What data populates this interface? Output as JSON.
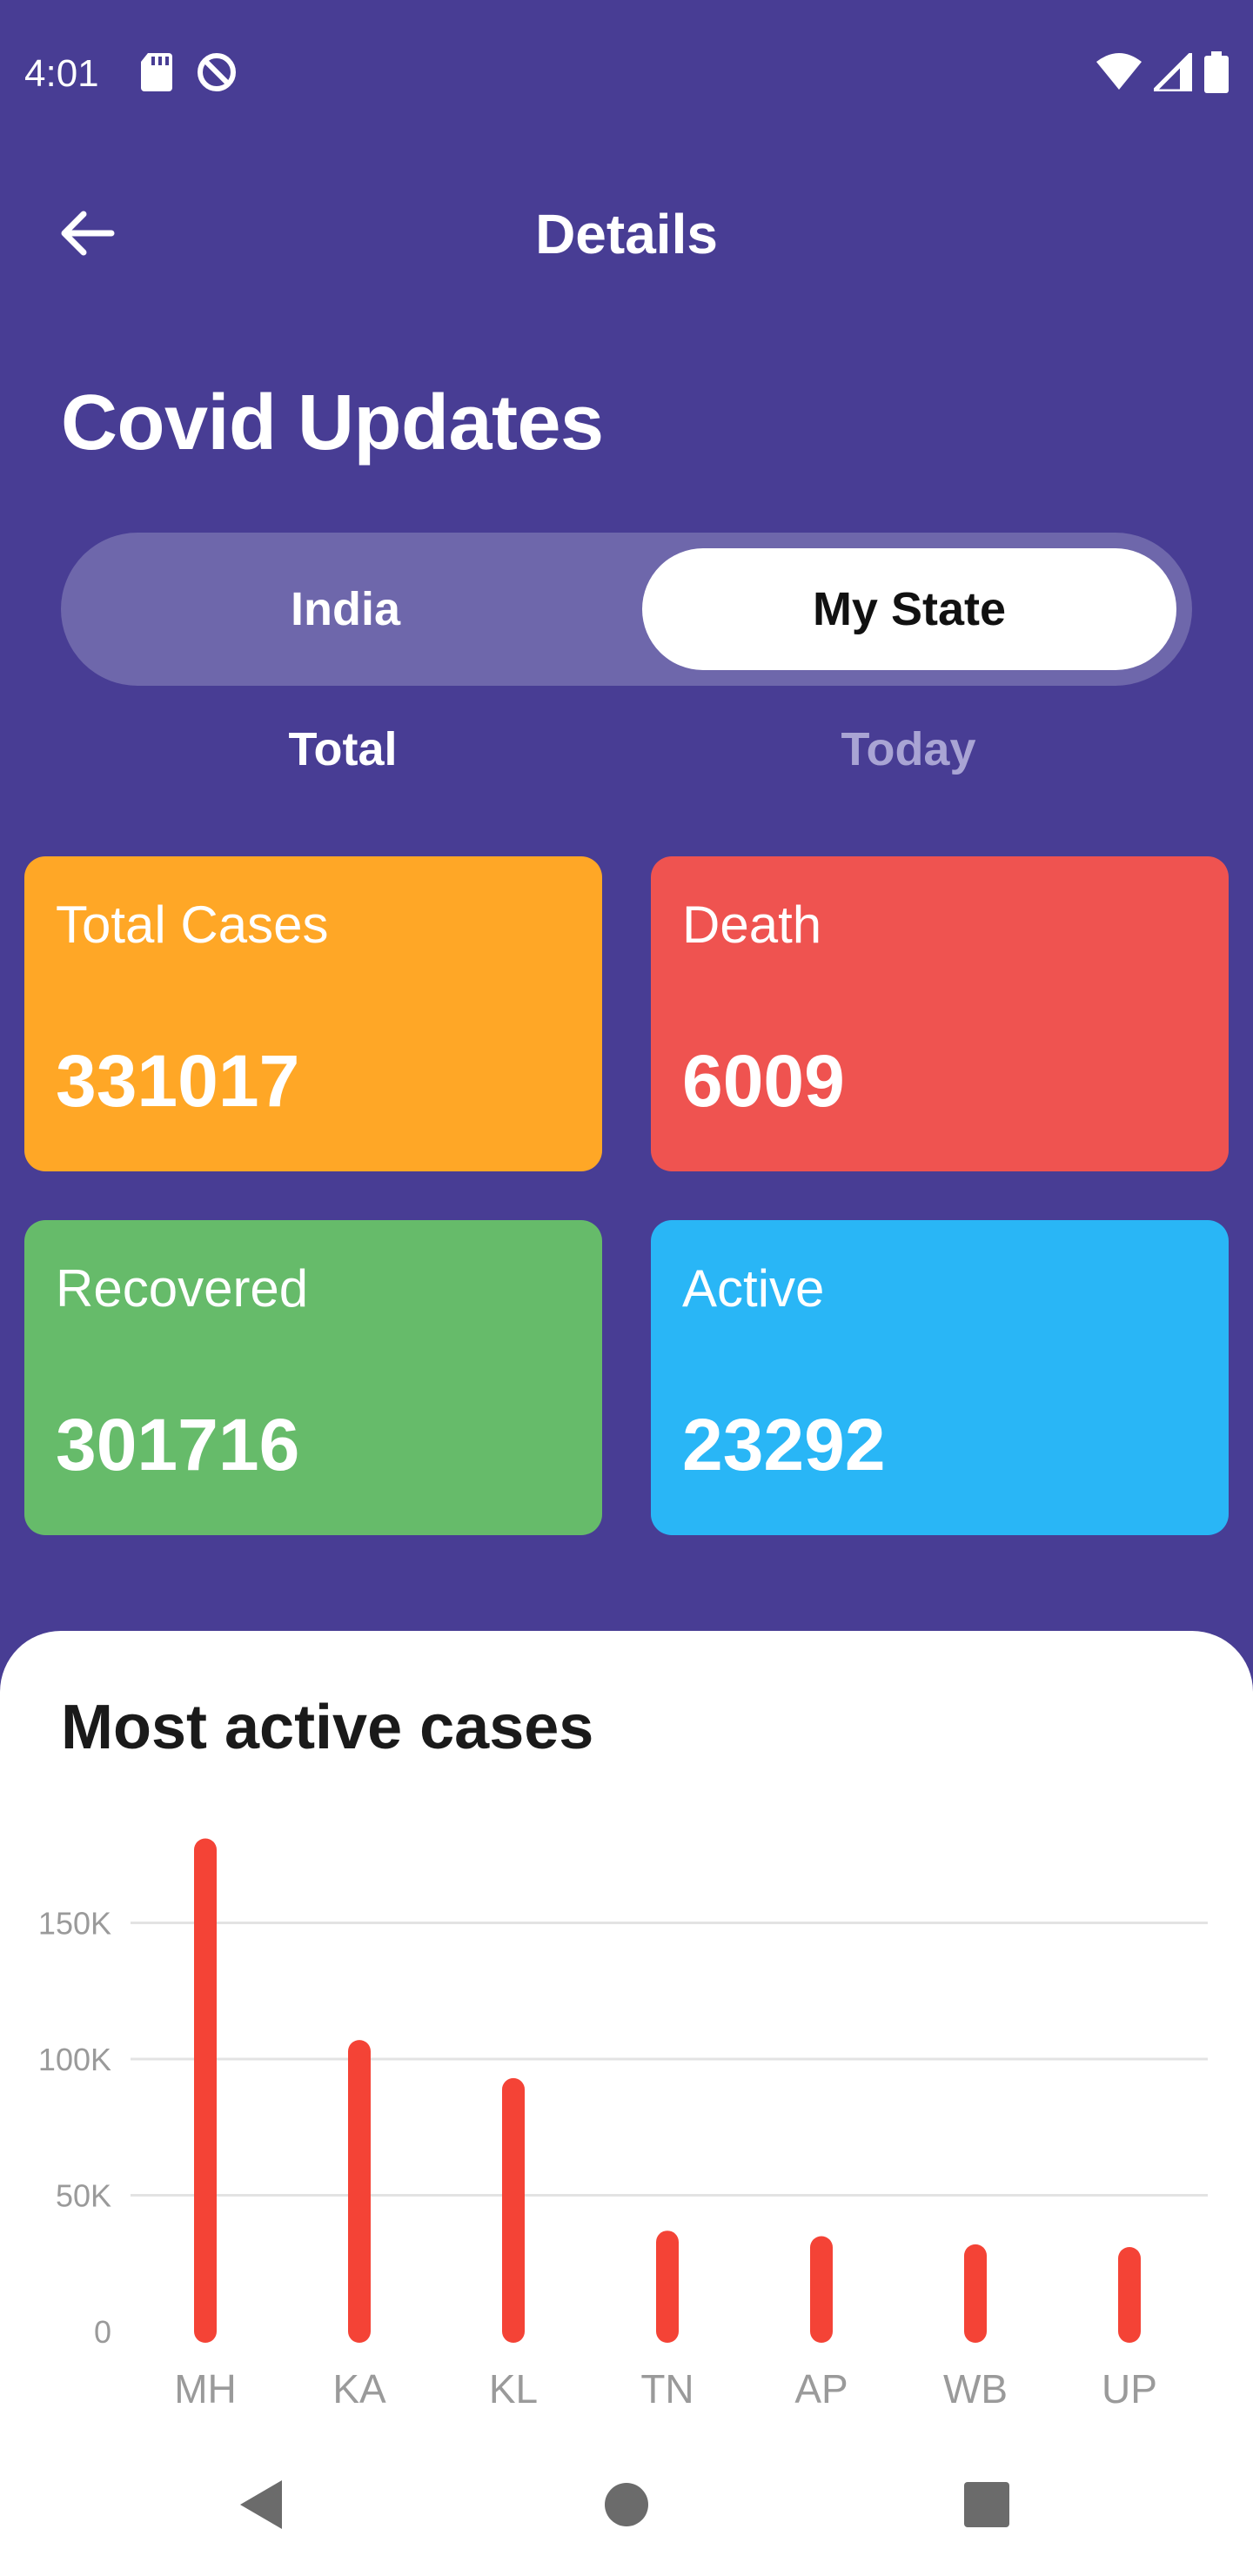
{
  "status_bar": {
    "time": "4:01",
    "icons_left": [
      "sd-card-icon",
      "data-saver-icon"
    ],
    "icons_right": [
      "wifi-icon",
      "cell-signal-icon",
      "battery-icon"
    ]
  },
  "app_bar": {
    "title": "Details",
    "back_icon": "arrow-left-icon"
  },
  "heading": "Covid Updates",
  "segmented_control": {
    "options": [
      "India",
      "My State"
    ],
    "selected": "My State"
  },
  "sub_tabs": {
    "items": [
      "Total",
      "Today"
    ],
    "selected": "Total"
  },
  "stats": {
    "total_cases": {
      "label": "Total Cases",
      "value": "331017",
      "color": "#FFA726"
    },
    "death": {
      "label": "Death",
      "value": "6009",
      "color": "#EF5350"
    },
    "recovered": {
      "label": "Recovered",
      "value": "301716",
      "color": "#66BB6A"
    },
    "active": {
      "label": "Active",
      "value": "23292",
      "color": "#29B6F6"
    }
  },
  "chart_section": {
    "title": "Most active cases"
  },
  "chart_data": {
    "type": "bar",
    "categories": [
      "MH",
      "KA",
      "KL",
      "TN",
      "AP",
      "WB",
      "UP"
    ],
    "values": [
      181000,
      107000,
      93000,
      37000,
      35000,
      32000,
      31000
    ],
    "y_ticks": [
      0,
      50000,
      100000,
      150000
    ],
    "y_tick_labels": [
      "0",
      "50K",
      "100K",
      "150K"
    ],
    "ylim": [
      0,
      185000
    ],
    "bar_color": "#F44336",
    "grid": true,
    "title": "",
    "xlabel": "",
    "ylabel": ""
  },
  "nav_bar": {
    "buttons": [
      "back-triangle-icon",
      "home-circle-icon",
      "recents-square-icon"
    ]
  }
}
